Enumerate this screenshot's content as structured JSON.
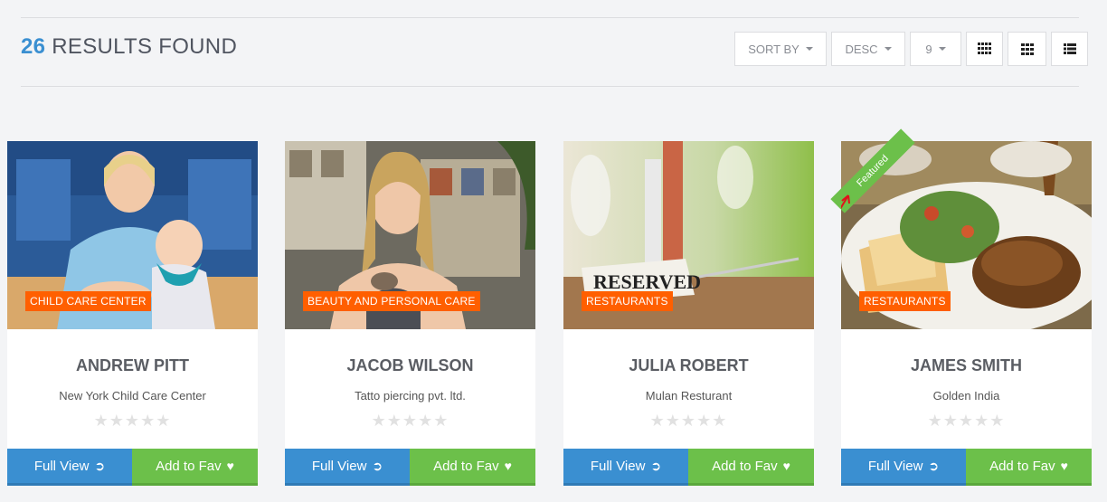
{
  "header": {
    "results_count": "26",
    "results_text": "RESULTS FOUND",
    "sort_by_label": "SORT BY",
    "order_label": "DESC",
    "per_page_label": "9"
  },
  "cards": [
    {
      "category": "CHILD CARE CENTER",
      "name": "ANDREW PITT",
      "company": "New York Child Care Center",
      "stars": "★★★★★",
      "full_view": "Full View",
      "add_fav": "Add to Fav"
    },
    {
      "category": "BEAUTY AND PERSONAL CARE",
      "name": "JACOB WILSON",
      "company": "Tatto piercing pvt. ltd.",
      "stars": "★★★★★",
      "full_view": "Full View",
      "add_fav": "Add to Fav"
    },
    {
      "category": "RESTAURANTS",
      "name": "JULIA ROBERT",
      "company": "Mulan Resturant",
      "stars": "★★★★★",
      "full_view": "Full View",
      "add_fav": "Add to Fav",
      "sign_text": "RESERVED"
    },
    {
      "category": "RESTAURANTS",
      "name": "JAMES SMITH",
      "company": "Golden India",
      "stars": "★★★★★",
      "full_view": "Full View",
      "add_fav": "Add to Fav",
      "badge": "Featured"
    }
  ],
  "colors": {
    "accent_blue": "#3a8fd1",
    "accent_green": "#6cc04a",
    "category_orange": "#ff5f00"
  }
}
